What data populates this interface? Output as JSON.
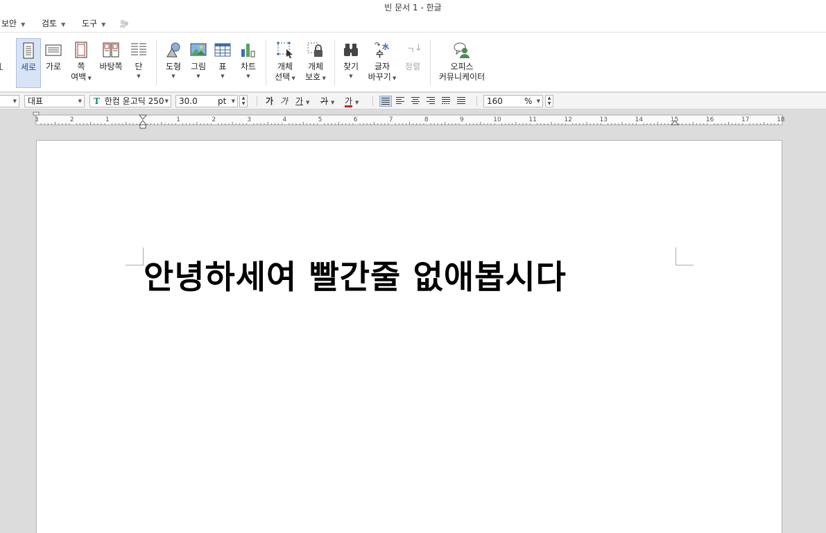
{
  "window": {
    "title": "빈 문서 1 - 한글"
  },
  "menu": {
    "items": [
      {
        "label": "보안"
      },
      {
        "label": "검토"
      },
      {
        "label": "도구"
      }
    ]
  },
  "ribbon": {
    "vertical": {
      "label": "세로"
    },
    "horizontal": {
      "label": "가로"
    },
    "margin": {
      "label1": "쪽",
      "label2": "여백"
    },
    "background": {
      "label": "바탕쪽"
    },
    "columns": {
      "label": "단"
    },
    "shape": {
      "label": "도형"
    },
    "picture": {
      "label": "그림"
    },
    "table": {
      "label": "표"
    },
    "chart": {
      "label": "차트"
    },
    "select_object": {
      "label1": "개체",
      "label2": "선택"
    },
    "protect_object": {
      "label1": "개체",
      "label2": "보호"
    },
    "find": {
      "label": "찾기"
    },
    "replace": {
      "label1": "글자",
      "label2": "바꾸기"
    },
    "arrange": {
      "label": "정렬"
    },
    "office": {
      "label1": "오피스",
      "label2": "커뮤니케이터"
    },
    "replace_icon_text": {
      "top": "水",
      "bottom": "수"
    },
    "arrange_icon_text": "ㄱ"
  },
  "format": {
    "style": "대표",
    "font": "한컴 윤고딕 250",
    "font_icon": "T",
    "size": "30.0",
    "unit": "pt",
    "bold": "가",
    "italic": "가",
    "underline": "가",
    "strike": "가",
    "color": "가",
    "line_spacing": "160",
    "line_spacing_unit": "%"
  },
  "ruler": {
    "left_numbers": [
      "3",
      "2",
      "1"
    ],
    "right_numbers": [
      "1",
      "2",
      "3",
      "4",
      "5",
      "6",
      "7",
      "8",
      "9",
      "10",
      "11",
      "12",
      "13",
      "14",
      "15",
      "16",
      "17",
      "18"
    ]
  },
  "document": {
    "text": "안녕하세여 빨간줄 없애봅시다"
  }
}
